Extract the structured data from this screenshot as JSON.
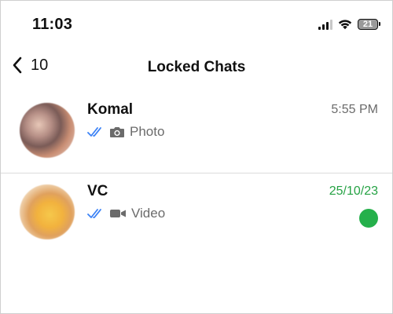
{
  "status_bar": {
    "time": "11:03",
    "battery_level": "21",
    "icons": [
      "signal-icon",
      "wifi-icon",
      "battery-icon"
    ]
  },
  "header": {
    "back_count": "10",
    "title": "Locked Chats",
    "icons": [
      "back-chevron-icon"
    ]
  },
  "chats": [
    {
      "name": "Komal",
      "preview_icon": "camera-icon",
      "preview_text": "Photo",
      "time": "5:55 PM",
      "read_receipt_icon": "double-check-icon",
      "unread": false
    },
    {
      "name": "VC",
      "preview_icon": "video-icon",
      "preview_text": "Video",
      "time": "25/10/23",
      "read_receipt_icon": "double-check-icon",
      "unread": true
    }
  ],
  "colors": {
    "accent_green": "#25a244",
    "receipt_blue": "#3b82f6",
    "secondary_text": "#6b6b6b",
    "divider": "#dcdcdc"
  }
}
